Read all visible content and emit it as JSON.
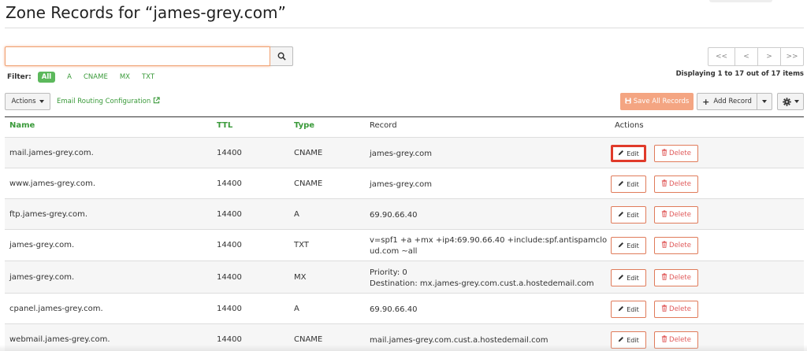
{
  "page": {
    "title": "Zone Records for “james-grey.com”"
  },
  "search": {
    "value": "",
    "placeholder": "",
    "icon": "search-icon"
  },
  "pagination": {
    "first": "<<",
    "prev": "<",
    "next": ">",
    "last": ">>",
    "summary": "Displaying 1 to 17 out of 17 items"
  },
  "filter": {
    "label": "Filter:",
    "options": [
      "All",
      "A",
      "CNAME",
      "MX",
      "TXT"
    ],
    "selected": "All"
  },
  "toolbar": {
    "actions_label": "Actions",
    "email_routing_label": "Email Routing Configuration",
    "save_all_label": "Save All Records",
    "add_record_label": "Add Record"
  },
  "table": {
    "headers": {
      "name": "Name",
      "ttl": "TTL",
      "type": "Type",
      "record": "Record",
      "actions": "Actions"
    },
    "rows": [
      {
        "name": "mail.james-grey.com.",
        "ttl": "14400",
        "type": "CNAME",
        "record_lines": [
          "james-grey.com"
        ]
      },
      {
        "name": "www.james-grey.com.",
        "ttl": "14400",
        "type": "CNAME",
        "record_lines": [
          "james-grey.com"
        ]
      },
      {
        "name": "ftp.james-grey.com.",
        "ttl": "14400",
        "type": "A",
        "record_lines": [
          "69.90.66.40"
        ]
      },
      {
        "name": "james-grey.com.",
        "ttl": "14400",
        "type": "TXT",
        "record_lines": [
          "v=spf1 +a +mx +ip4:69.90.66.40 +include:spf.antispamclo",
          "ud.com ~all"
        ]
      },
      {
        "name": "james-grey.com.",
        "ttl": "14400",
        "type": "MX",
        "record_lines": [
          "Priority: 0",
          "Destination: mx.james-grey.com.cust.a.hostedemail.com"
        ]
      },
      {
        "name": "cpanel.james-grey.com.",
        "ttl": "14400",
        "type": "A",
        "record_lines": [
          "69.90.66.40"
        ]
      },
      {
        "name": "webmail.james-grey.com.",
        "ttl": "14400",
        "type": "CNAME",
        "record_lines": [
          "mail.james-grey.com.cust.a.hostedemail.com"
        ]
      }
    ],
    "edit_label": "Edit",
    "delete_label": "Delete",
    "highlighted_row": 0
  },
  "colors": {
    "accent_green": "#3a9a3a",
    "filter_active": "#5cb85c",
    "save_button": "#f4a582",
    "button_border": "#e07b5a",
    "delete_text": "#e05a5a",
    "highlight": "#e03a2a"
  }
}
